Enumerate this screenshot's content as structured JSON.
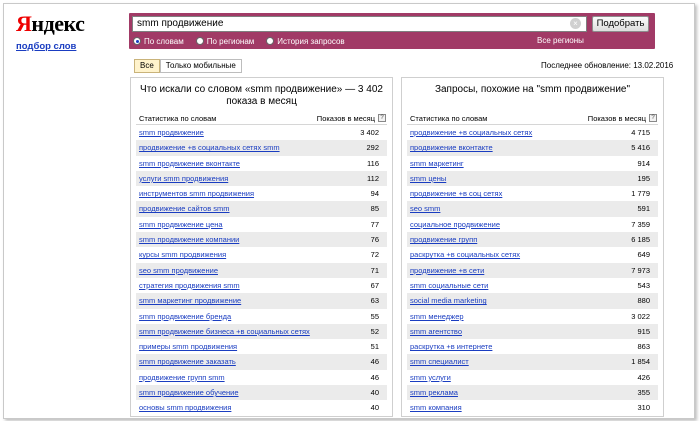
{
  "logo": {
    "first": "Я",
    "rest": "ндекс",
    "subtitle": "подбор слов"
  },
  "search": {
    "query": "smm продвижение",
    "submit_label": "Подобрать",
    "clear_glyph": "×"
  },
  "modes": [
    {
      "label": "По словам",
      "active": true
    },
    {
      "label": "По регионам",
      "active": false
    },
    {
      "label": "История запросов",
      "active": false
    }
  ],
  "region_link": "Все регионы",
  "tabs": [
    {
      "label": "Все",
      "active": true
    },
    {
      "label": "Только мобильные",
      "active": false
    }
  ],
  "updated": "Последнее обновление: 13.02.2016",
  "left": {
    "title": "Что искали со словом «smm продвижение» — 3 402 показа в месяц",
    "col_phrase": "Статистика по словам",
    "col_count": "Показов в месяц",
    "help": "?",
    "rows": [
      {
        "phrase": "smm продвижение",
        "count": "3 402"
      },
      {
        "phrase": "продвижение +в социальных сетях smm",
        "count": "292"
      },
      {
        "phrase": "smm продвижение вконтакте",
        "count": "116"
      },
      {
        "phrase": "услуги smm продвижения",
        "count": "112"
      },
      {
        "phrase": "инструментов smm продвижения",
        "count": "94"
      },
      {
        "phrase": "продвижение сайтов smm",
        "count": "85"
      },
      {
        "phrase": "smm продвижение цена",
        "count": "77"
      },
      {
        "phrase": "smm продвижение компании",
        "count": "76"
      },
      {
        "phrase": "курсы smm продвижения",
        "count": "72"
      },
      {
        "phrase": "seo smm продвижение",
        "count": "71"
      },
      {
        "phrase": "стратегия продвижения smm",
        "count": "67"
      },
      {
        "phrase": "smm маркетинг продвижение",
        "count": "63"
      },
      {
        "phrase": "smm продвижение бренда",
        "count": "55"
      },
      {
        "phrase": "smm продвижение бизнеса +в социальных сетях",
        "count": "52"
      },
      {
        "phrase": "примеры smm продвижения",
        "count": "51"
      },
      {
        "phrase": "smm продвижение заказать",
        "count": "46"
      },
      {
        "phrase": "продвижение групп smm",
        "count": "46"
      },
      {
        "phrase": "smm продвижение обучение",
        "count": "40"
      },
      {
        "phrase": "основы smm продвижения",
        "count": "40"
      }
    ]
  },
  "right": {
    "title": "Запросы, похожие на \"smm продвижение\"",
    "col_phrase": "Статистика по словам",
    "col_count": "Показов в месяц",
    "help": "?",
    "rows": [
      {
        "phrase": "продвижение +в социальных сетях",
        "count": "4 715"
      },
      {
        "phrase": "продвижение вконтакте",
        "count": "5 416"
      },
      {
        "phrase": "smm маркетинг",
        "count": "914"
      },
      {
        "phrase": "smm цены",
        "count": "195"
      },
      {
        "phrase": "продвижение +в соц сетях",
        "count": "1 779"
      },
      {
        "phrase": "seo smm",
        "count": "591"
      },
      {
        "phrase": "социальное продвижение",
        "count": "7 359"
      },
      {
        "phrase": "продвижение групп",
        "count": "6 185"
      },
      {
        "phrase": "раскрутка +в социальных сетях",
        "count": "649"
      },
      {
        "phrase": "продвижение +в сети",
        "count": "7 973"
      },
      {
        "phrase": "smm социальные сети",
        "count": "543"
      },
      {
        "phrase": "social media marketing",
        "count": "880"
      },
      {
        "phrase": "smm менеджер",
        "count": "3 022"
      },
      {
        "phrase": "smm агентство",
        "count": "915"
      },
      {
        "phrase": "раскрутка +в интернете",
        "count": "863"
      },
      {
        "phrase": "smm специалист",
        "count": "1 854"
      },
      {
        "phrase": "smm услуги",
        "count": "426"
      },
      {
        "phrase": "smm реклама",
        "count": "355"
      },
      {
        "phrase": "smm компания",
        "count": "310"
      }
    ]
  }
}
